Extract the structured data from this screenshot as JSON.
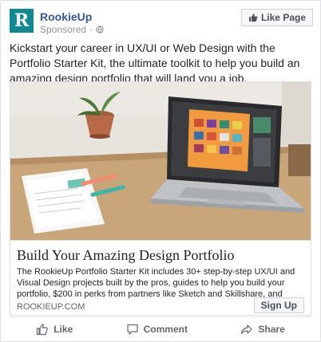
{
  "post": {
    "page_name": "RookieUp",
    "avatar_letter": "R",
    "sponsored": "Sponsored",
    "like_page_label": "Like Page",
    "text": "Kickstart your career in UX/UI or Web Design with the Portfolio Starter Kit, the ultimate toolkit to help you build an amazing design portfolio that will land you a job."
  },
  "link": {
    "title": "Build Your Amazing Design Portfolio",
    "description": "The RookieUp Portfolio Starter Kit includes 30+ step-by-step UX/UI and Visual Design projects built by the pros, guides to help you build your portfolio, $200 in perks from partners like Sketch and Skillshare, and more. Get lifetime access for…",
    "domain": "ROOKIEUP.COM",
    "cta_label": "Sign Up"
  },
  "actions": {
    "like": "Like",
    "comment": "Comment",
    "share": "Share"
  },
  "colors": {
    "brand": "#0f8a92",
    "link": "#365899"
  },
  "icons": {
    "globe": "globe-icon",
    "thumbs_up": "thumbs-up-icon",
    "comment": "comment-icon",
    "share": "share-icon"
  }
}
